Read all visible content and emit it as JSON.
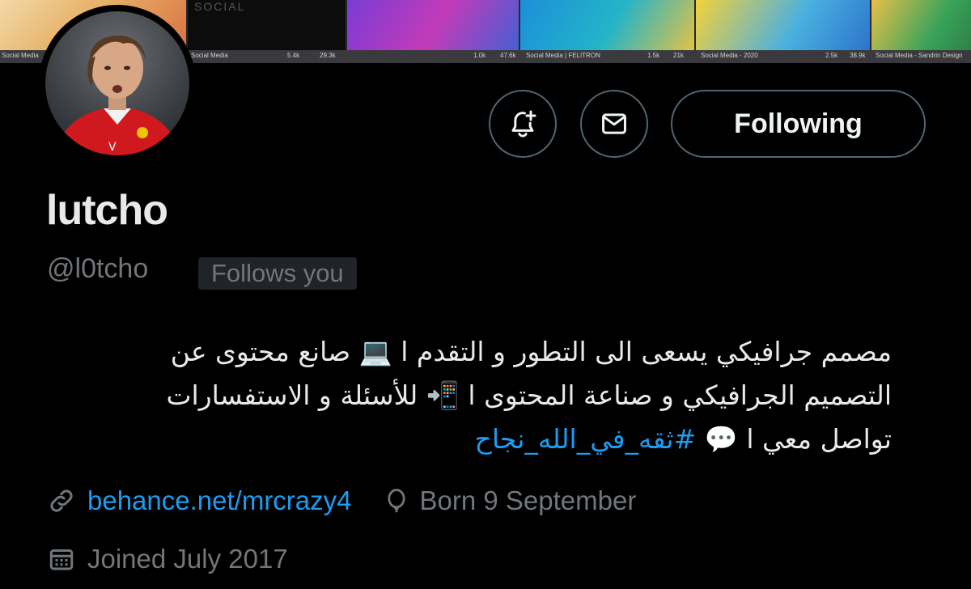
{
  "banner": {
    "captions": [
      "Social Media",
      "Social Media",
      "Social Media | FELITRON",
      "Social Media - 2020",
      "Social Media - Sandrin Design"
    ],
    "stats": [
      "5.4k",
      "29.3k",
      "1.0k",
      "47.6k",
      "1.5k",
      "21k",
      "2.5k",
      "38.9k"
    ],
    "text": "SOCIAL"
  },
  "actions": {
    "notify_icon": "bell-plus-icon",
    "message_icon": "envelope-icon",
    "follow_label": "Following"
  },
  "profile": {
    "display_name": "lutcho",
    "handle": "@l0tcho",
    "follows_you_badge": "Follows you"
  },
  "bio": {
    "line1_a": "مصمم جرافيكي يسعى الى التطور و التقدم ا",
    "emoji_laptop": "💻",
    "line1_b": "صانع محتوى عن",
    "line2_a": "التصميم الجرافيكي و صناعة المحتوى ا",
    "emoji_phone": "📲",
    "line2_b": "للأسئلة و الاستفسارات",
    "line3_a": "تواصل معي ا",
    "emoji_speech": "💬",
    "hashtag": "#ثقه_في_الله_نجاح"
  },
  "meta": {
    "website": "behance.net/mrcrazy4",
    "birthday": "Born 9 September",
    "joined": "Joined July 2017"
  },
  "colors": {
    "background": "#000000",
    "accent": "#1d9bf0",
    "muted": "#71767b",
    "border": "#536471"
  }
}
